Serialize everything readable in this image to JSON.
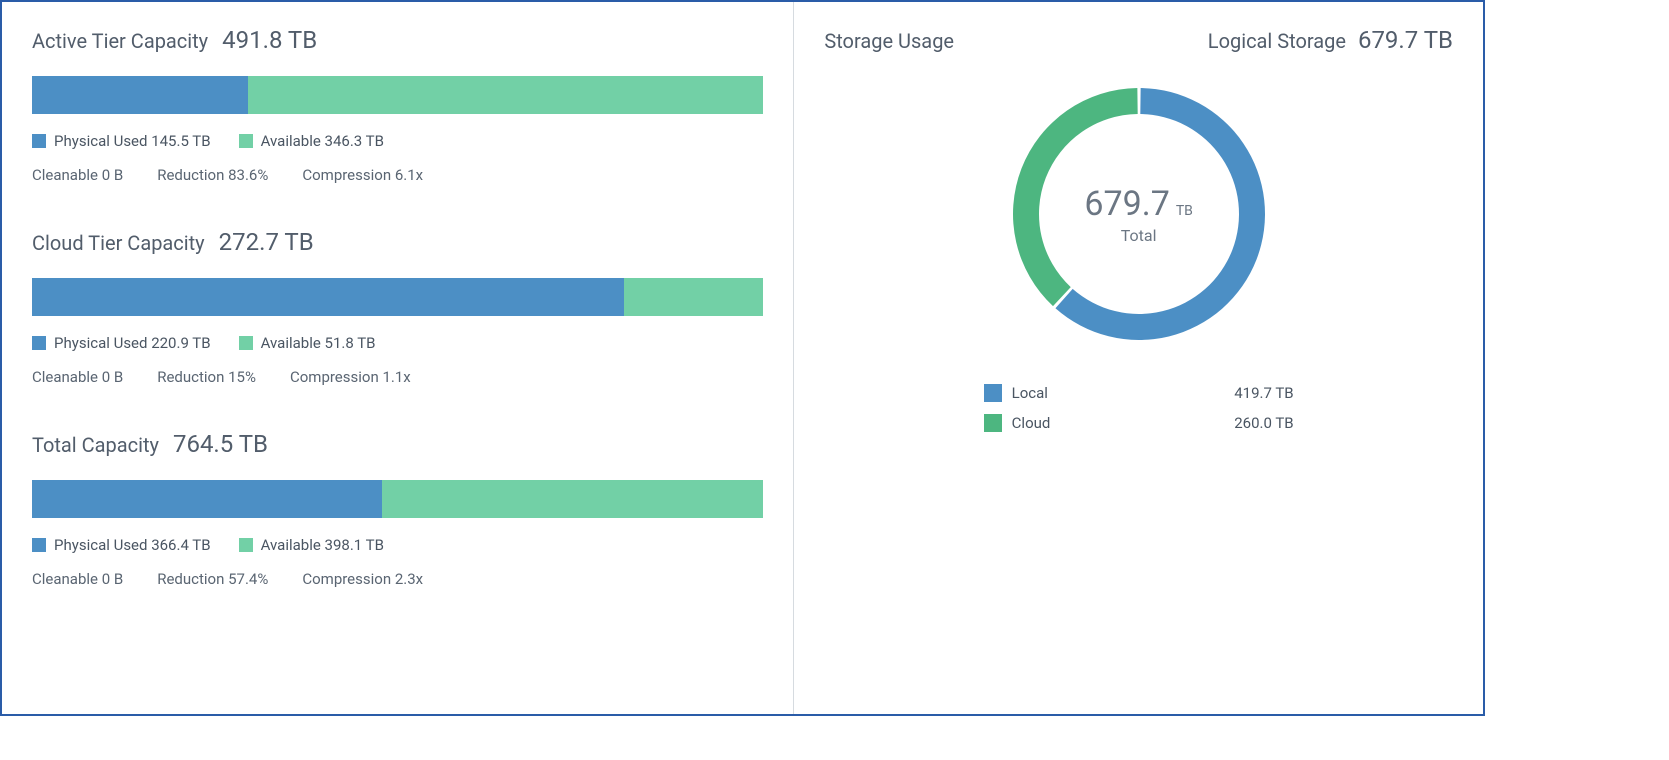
{
  "colors": {
    "used": "#4c8fc5",
    "available": "#72d0a6",
    "local": "#4c8fc5",
    "cloud": "#4db680"
  },
  "left": {
    "tiers": [
      {
        "title": "Active Tier Capacity",
        "value": "491.8 TB",
        "used_pct": 29.6,
        "used_label": "Physical Used 145.5 TB",
        "avail_label": "Available 346.3 TB",
        "stats": [
          "Cleanable 0 B",
          "Reduction 83.6%",
          "Compression 6.1x"
        ]
      },
      {
        "title": "Cloud Tier Capacity",
        "value": "272.7 TB",
        "used_pct": 81.0,
        "used_label": "Physical Used 220.9 TB",
        "avail_label": "Available 51.8 TB",
        "stats": [
          "Cleanable 0 B",
          "Reduction 15%",
          "Compression 1.1x"
        ]
      },
      {
        "title": "Total Capacity",
        "value": "764.5 TB",
        "used_pct": 47.9,
        "used_label": "Physical Used 366.4 TB",
        "avail_label": "Available 398.1 TB",
        "stats": [
          "Cleanable 0 B",
          "Reduction 57.4%",
          "Compression 2.3x"
        ]
      }
    ]
  },
  "right": {
    "title": "Storage Usage",
    "logical_label": "Logical Storage",
    "logical_value": "679.7 TB",
    "center_value": "679.7",
    "center_unit": "TB",
    "center_sub": "Total",
    "legend": [
      {
        "name": "Local",
        "value": "419.7 TB",
        "color": "#4c8fc5"
      },
      {
        "name": "Cloud",
        "value": "260.0 TB",
        "color": "#4db680"
      }
    ]
  },
  "chart_data": [
    {
      "type": "bar",
      "title": "Active Tier Capacity",
      "categories": [
        "Physical Used",
        "Available"
      ],
      "values": [
        145.5,
        346.3
      ],
      "unit": "TB",
      "total": 491.8,
      "cleanable_bytes": 0,
      "reduction_pct": 83.6,
      "compression_x": 6.1
    },
    {
      "type": "bar",
      "title": "Cloud Tier Capacity",
      "categories": [
        "Physical Used",
        "Available"
      ],
      "values": [
        220.9,
        51.8
      ],
      "unit": "TB",
      "total": 272.7,
      "cleanable_bytes": 0,
      "reduction_pct": 15.0,
      "compression_x": 1.1
    },
    {
      "type": "bar",
      "title": "Total Capacity",
      "categories": [
        "Physical Used",
        "Available"
      ],
      "values": [
        366.4,
        398.1
      ],
      "unit": "TB",
      "total": 764.5,
      "cleanable_bytes": 0,
      "reduction_pct": 57.4,
      "compression_x": 2.3
    },
    {
      "type": "pie",
      "title": "Storage Usage — Logical Storage",
      "series": [
        {
          "name": "Local",
          "value": 419.7
        },
        {
          "name": "Cloud",
          "value": 260.0
        }
      ],
      "unit": "TB",
      "total": 679.7
    }
  ]
}
